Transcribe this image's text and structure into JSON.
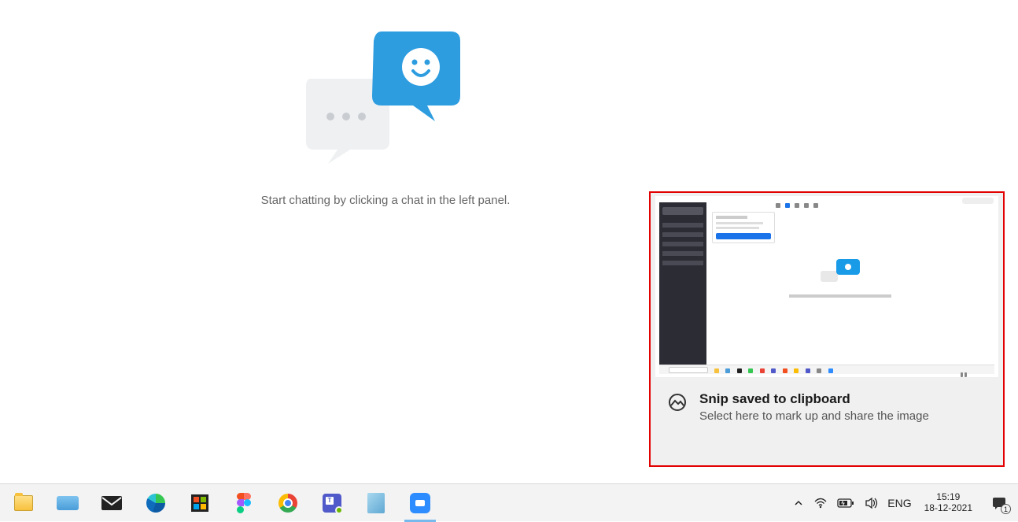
{
  "main": {
    "empty_state_text": "Start chatting by clicking a chat in the left panel."
  },
  "notification": {
    "title": "Snip saved to clipboard",
    "description": "Select here to mark up and share the image"
  },
  "taskbar": {
    "items": [
      {
        "name": "file-explorer"
      },
      {
        "name": "on-screen-keyboard"
      },
      {
        "name": "mail"
      },
      {
        "name": "edge"
      },
      {
        "name": "microsoft-store"
      },
      {
        "name": "figma"
      },
      {
        "name": "chrome"
      },
      {
        "name": "teams"
      },
      {
        "name": "notepad"
      },
      {
        "name": "zoom",
        "active": true
      }
    ],
    "tray": {
      "language": "ENG",
      "time": "15:19",
      "date": "18-12-2021",
      "notification_count": "1"
    }
  }
}
